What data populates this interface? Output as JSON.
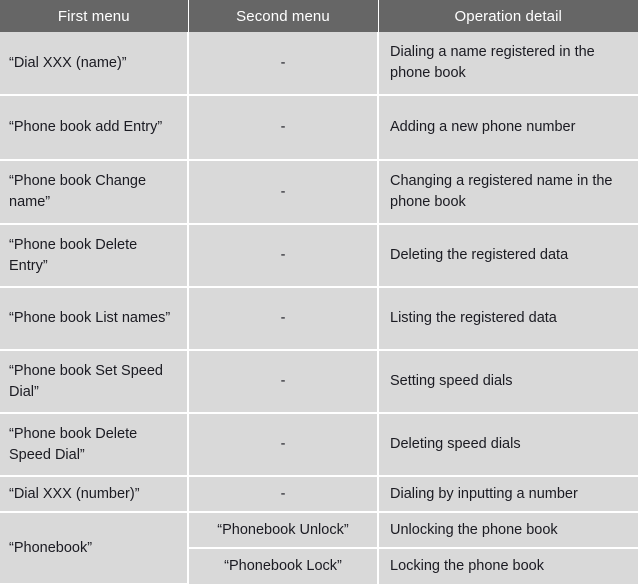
{
  "table": {
    "headers": [
      {
        "label": "First menu"
      },
      {
        "label": "Second menu"
      },
      {
        "label": "Operation detail"
      }
    ],
    "rows": [
      {
        "first": "“Dial XXX (name)”",
        "second": "-",
        "detail": "Dialing a name registered in the phone book"
      },
      {
        "first": "“Phone book add Entry”",
        "second": "-",
        "detail": "Adding a new phone number"
      },
      {
        "first": "“Phone book Change name”",
        "second": "-",
        "detail": "Changing a registered name in the phone book"
      },
      {
        "first": "“Phone book Delete Entry”",
        "second": "-",
        "detail": "Deleting the registered data"
      },
      {
        "first": "“Phone book List names”",
        "second": "-",
        "detail": "Listing the registered data"
      },
      {
        "first": "“Phone book Set Speed Dial”",
        "second": "-",
        "detail": "Setting speed dials"
      },
      {
        "first": "“Phone book Delete Speed Dial”",
        "second": "-",
        "detail": "Deleting speed dials"
      },
      {
        "first": "“Dial XXX (number)”",
        "second": "-",
        "detail": "Dialing by inputting a number"
      },
      {
        "first": "“Phonebook”",
        "second": "“Phonebook Unlock”",
        "detail": "Unlocking the phone book"
      },
      {
        "first": "",
        "second": "“Phonebook Lock”",
        "detail": "Locking the phone book"
      }
    ]
  },
  "colors": {
    "header_background": "#666666",
    "header_text": "#ffffff",
    "cell_background": "#d9d9d9",
    "cell_text": "#1b1b22",
    "gridline": "#ffffff"
  }
}
